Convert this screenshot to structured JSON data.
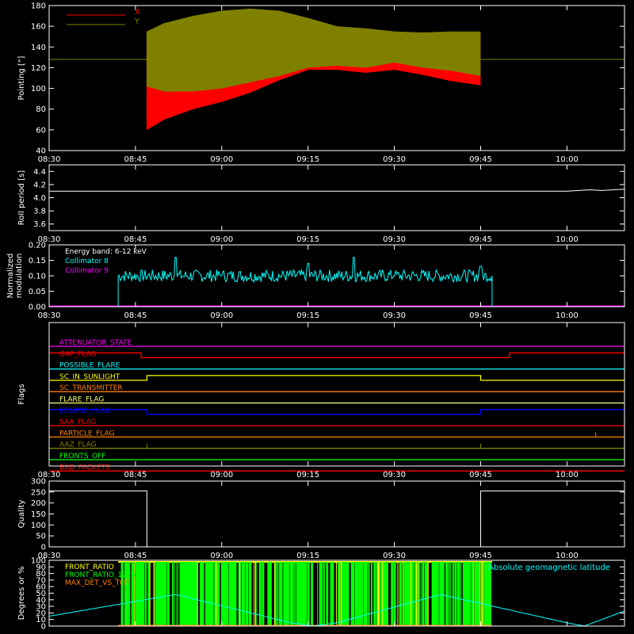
{
  "chart_data": [
    {
      "id": "pointing",
      "type": "line",
      "ylabel": "Pointing [\"]",
      "ylim": [
        40,
        180
      ],
      "yticks": [
        40,
        60,
        80,
        100,
        120,
        140,
        160,
        180
      ],
      "xticks": [
        "08:30",
        "08:45",
        "09:00",
        "09:15",
        "09:30",
        "09:45",
        "10:00"
      ],
      "xlim_minutes": [
        510,
        610
      ],
      "legend": [
        {
          "name": "X",
          "color": "#ff0000"
        },
        {
          "name": "Y",
          "color": "#808000"
        }
      ],
      "reference_level": 128,
      "active_range": [
        "08:47",
        "09:45"
      ],
      "series": [
        {
          "name": "X",
          "color": "#ff0000",
          "x": [
            "08:47",
            "08:50",
            "08:55",
            "09:00",
            "09:05",
            "09:10",
            "09:15",
            "09:20",
            "09:25",
            "09:30",
            "09:35",
            "09:40",
            "09:45"
          ],
          "low": [
            60,
            70,
            80,
            87,
            96,
            108,
            118,
            118,
            115,
            118,
            113,
            107,
            103
          ],
          "high": [
            150,
            150,
            155,
            162,
            168,
            170,
            165,
            158,
            155,
            152,
            152,
            153,
            154
          ]
        },
        {
          "name": "Y",
          "color": "#808000",
          "x": [
            "08:47",
            "08:50",
            "08:55",
            "09:00",
            "09:05",
            "09:10",
            "09:15",
            "09:20",
            "09:25",
            "09:30",
            "09:35",
            "09:40",
            "09:45"
          ],
          "low": [
            102,
            97,
            97,
            100,
            106,
            112,
            120,
            122,
            120,
            125,
            120,
            117,
            112
          ],
          "high": [
            155,
            163,
            170,
            175,
            177,
            175,
            168,
            160,
            158,
            155,
            154,
            155,
            155
          ]
        }
      ]
    },
    {
      "id": "roll",
      "type": "line",
      "ylabel": "Roll period [s]",
      "ylim": [
        3.5,
        4.5
      ],
      "yticks": [
        "3.6",
        "3.8",
        "4.0",
        "4.2",
        "4.4"
      ],
      "xticks": [
        "08:30",
        "08:45",
        "09:00",
        "09:15",
        "09:30",
        "09:45",
        "10:00"
      ],
      "series": [
        {
          "name": "roll_period",
          "color": "#ffffff",
          "x": [
            "08:30",
            "10:00",
            "10:04",
            "10:06",
            "10:08",
            "10:10"
          ],
          "values": [
            4.1,
            4.1,
            4.12,
            4.11,
            4.12,
            4.13
          ]
        }
      ]
    },
    {
      "id": "modulation",
      "type": "line",
      "ylabel": "Normalized modulation",
      "ylim": [
        0.0,
        0.2
      ],
      "yticks": [
        "0.00",
        "0.05",
        "0.10",
        "0.15",
        "0.20"
      ],
      "xticks": [
        "08:30",
        "08:45",
        "09:00",
        "09:15",
        "09:30",
        "09:45",
        "10:00"
      ],
      "annotation": "Energy band: 6-12 keV",
      "legend": [
        {
          "name": "Collimator 8",
          "color": "#00ffff"
        },
        {
          "name": "Collimator 9",
          "color": "#ff00ff"
        }
      ],
      "series": [
        {
          "name": "Collimator 8",
          "color": "#00ffff",
          "x": [
            "08:42",
            "08:52",
            "09:00",
            "09:15",
            "09:23",
            "09:30",
            "09:45",
            "09:47"
          ],
          "values": [
            0.1,
            0.16,
            0.1,
            0.14,
            0.16,
            0.1,
            0.13,
            0.1
          ],
          "mean": 0.1,
          "spread": 0.02,
          "active_range": [
            "08:42",
            "09:47"
          ]
        },
        {
          "name": "Collimator 9",
          "color": "#ff00ff",
          "x": [
            "08:30",
            "10:10"
          ],
          "values": [
            0.0,
            0.0
          ]
        }
      ]
    },
    {
      "id": "flags",
      "type": "line",
      "ylabel": "Flags",
      "xticks": [
        "08:30",
        "08:45",
        "09:00",
        "09:15",
        "09:30",
        "09:45",
        "10:00"
      ],
      "flags": [
        {
          "name": "ATTENUATOR_STATE",
          "color": "#ff00ff",
          "steps": []
        },
        {
          "name": "GAP_FLAG",
          "color": "#ff0000",
          "steps": [
            [
              "08:30",
              1
            ],
            [
              "08:46",
              0
            ],
            [
              "09:50",
              1
            ]
          ]
        },
        {
          "name": "POSSIBLE_FLARE",
          "color": "#00ffff",
          "steps": []
        },
        {
          "name": "SC_IN_SUNLIGHT",
          "color": "#ffff00",
          "steps": [
            [
              "08:30",
              0
            ],
            [
              "08:47",
              1
            ],
            [
              "09:45",
              0
            ]
          ]
        },
        {
          "name": "SC_TRANSMITTER",
          "color": "#ff8000",
          "steps": []
        },
        {
          "name": "FLARE_FLAG",
          "color": "#ffff80",
          "steps": []
        },
        {
          "name": "ECLIPSE_FLAG",
          "color": "#0000ff",
          "steps": [
            [
              "08:30",
              1
            ],
            [
              "08:47",
              0
            ],
            [
              "09:45",
              1
            ]
          ]
        },
        {
          "name": "SAA_FLAG",
          "color": "#ff0000",
          "steps": []
        },
        {
          "name": "PARTICLE_FLAG",
          "color": "#ff8000",
          "spikes": [
            "10:05",
            "10:10"
          ]
        },
        {
          "name": "AAZ_FLAG",
          "color": "#808000",
          "spikes": [
            "08:47",
            "09:45"
          ]
        },
        {
          "name": "FRONTS_OFF",
          "color": "#00ff00",
          "steps": []
        },
        {
          "name": "BAD_PACKETS",
          "color": "#ff0000",
          "steps": []
        }
      ]
    },
    {
      "id": "quality",
      "type": "line",
      "ylabel": "Quality",
      "ylim": [
        0,
        300
      ],
      "yticks": [
        0,
        50,
        100,
        150,
        200,
        250,
        300
      ],
      "xticks": [
        "08:30",
        "08:45",
        "09:00",
        "09:15",
        "09:30",
        "09:45",
        "10:00"
      ],
      "series": [
        {
          "name": "quality",
          "color": "#ffffff",
          "x": [
            "08:30",
            "08:47",
            "08:47",
            "09:45",
            "09:45",
            "10:10"
          ],
          "values": [
            255,
            255,
            0,
            0,
            255,
            255
          ]
        }
      ]
    },
    {
      "id": "ratios",
      "type": "line",
      "ylabel": "Degrees or %",
      "ylim": [
        0,
        100
      ],
      "yticks": [
        0,
        10,
        20,
        30,
        40,
        50,
        60,
        70,
        80,
        90,
        100
      ],
      "legend": [
        {
          "name": "FRONT_RATIO",
          "color": "#ffff00"
        },
        {
          "name": "FRONT_RATIO_1225",
          "color": "#00ff00"
        },
        {
          "name": "MAX_DET_VS_TOT",
          "color": "#ff8000"
        }
      ],
      "annotation": "Absolute geomagnetic latitude",
      "annotation_color": "#00ffff",
      "green_bar_range": [
        "08:42",
        "09:47"
      ],
      "latitude": {
        "color": "#00ffff",
        "x": [
          "08:30",
          "08:52",
          "09:12",
          "09:16",
          "09:20",
          "09:38",
          "10:00",
          "10:03",
          "10:10"
        ],
        "values": [
          15,
          48,
          5,
          0,
          5,
          48,
          5,
          0,
          23
        ]
      }
    }
  ]
}
